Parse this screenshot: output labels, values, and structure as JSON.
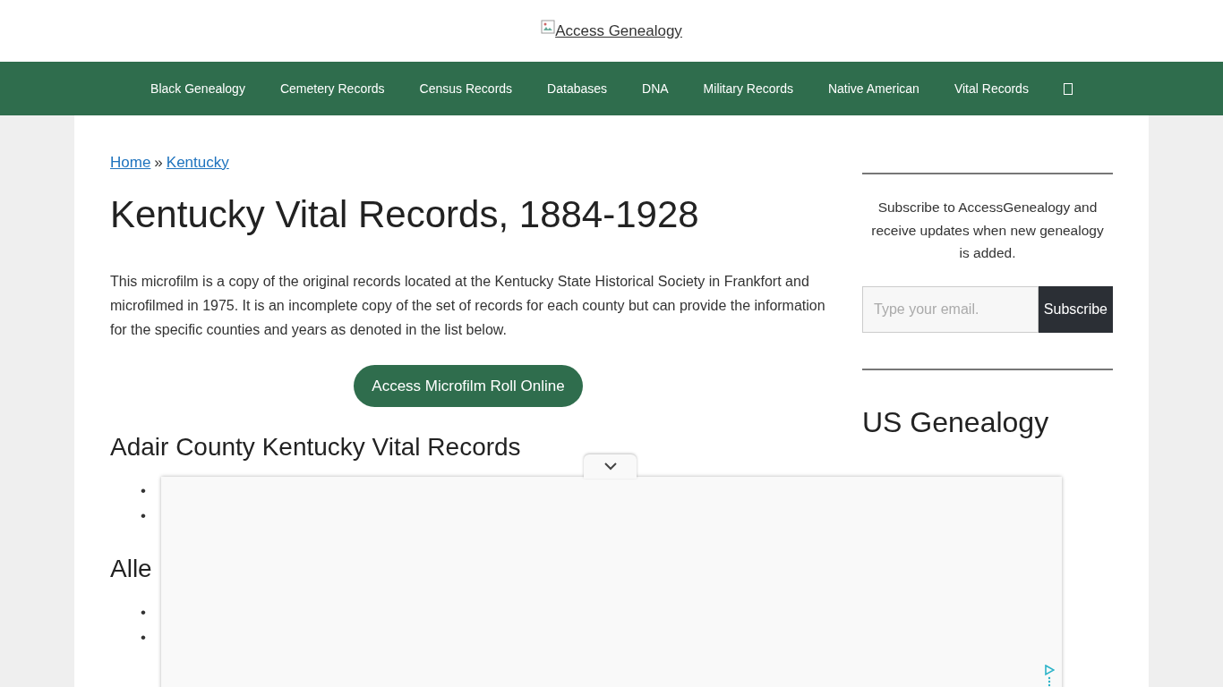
{
  "header": {
    "logo_alt": "Access Genealogy"
  },
  "nav": {
    "items": [
      {
        "label": "Black Genealogy"
      },
      {
        "label": "Cemetery Records"
      },
      {
        "label": "Census Records"
      },
      {
        "label": "Databases"
      },
      {
        "label": "DNA"
      },
      {
        "label": "Military Records"
      },
      {
        "label": "Native American"
      },
      {
        "label": "Vital Records",
        "kind": "text"
      },
      {
        "kind": "icon"
      }
    ]
  },
  "breadcrumb": [
    {
      "label": "Home"
    },
    {
      "label": "Kentucky"
    }
  ],
  "breadcrumb_separator": "»",
  "title": "Kentucky Vital Records, 1884-1928",
  "intro": "This microfilm is a copy of the original records located at the Kentucky State Historical Society in Frankfort and microfilmed in 1975. It is an incomplete copy of the set of records for each county but can provide the information for the specific counties and years as denoted in the list below.",
  "cta": "Access Microfilm Roll Online",
  "sections": [
    {
      "heading": "Adair County Kentucky Vital Records",
      "bullets": [
        "•",
        "•"
      ]
    },
    {
      "heading": "Alle",
      "bullets": [
        "•",
        "•"
      ]
    }
  ],
  "sidebar": {
    "subscribe_text": "Subscribe to AccessGenealogy and receive updates when new genealogy is added.",
    "email_placeholder": "Type your email.",
    "subscribe_button": "Subscribe",
    "heading": "US Genealogy"
  }
}
